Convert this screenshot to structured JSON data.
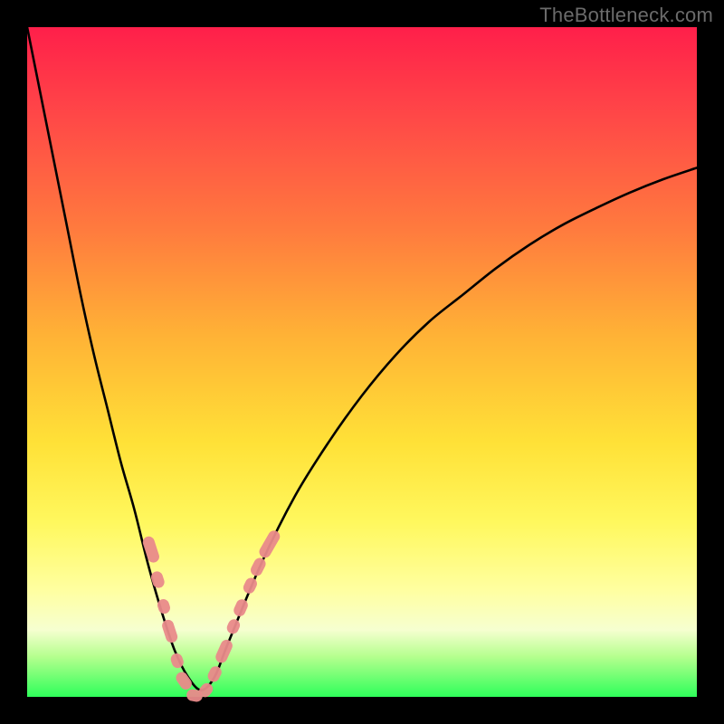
{
  "watermark": "TheBottleneck.com",
  "colors": {
    "background": "#000000",
    "gradient_stops": [
      "#ff1f4a",
      "#ff4a47",
      "#ff7a3e",
      "#ffb236",
      "#ffe137",
      "#fff85e",
      "#ffffa0",
      "#f6ffd0",
      "#b5ff8e",
      "#2eff5a"
    ],
    "curve": "#000000",
    "markers": "#e98a8a"
  },
  "chart_data": {
    "type": "line",
    "title": "",
    "xlabel": "",
    "ylabel": "",
    "xlim": [
      0,
      100
    ],
    "ylim": [
      0,
      100
    ],
    "series": [
      {
        "name": "bottleneck-curve",
        "x": [
          0,
          2,
          4,
          6,
          8,
          10,
          12,
          14,
          16,
          18,
          20,
          22,
          24,
          26,
          28,
          30,
          35,
          40,
          45,
          50,
          55,
          60,
          65,
          70,
          75,
          80,
          85,
          90,
          95,
          100
        ],
        "y": [
          100,
          90,
          80,
          70,
          60,
          51,
          43,
          35,
          28,
          20,
          13,
          7,
          3,
          1,
          3,
          8,
          20,
          30,
          38,
          45,
          51,
          56,
          60,
          64,
          67.5,
          70.5,
          73,
          75.3,
          77.3,
          79
        ]
      }
    ],
    "markers": [
      {
        "name": "highlight-cluster",
        "kind": "pill",
        "points": [
          {
            "x": 18.5,
            "y": 22,
            "len": 4,
            "angle": -72
          },
          {
            "x": 19.5,
            "y": 17.5,
            "len": 2.5,
            "angle": -72
          },
          {
            "x": 20.4,
            "y": 13.5,
            "len": 2.2,
            "angle": -72
          },
          {
            "x": 21.3,
            "y": 9.8,
            "len": 3.5,
            "angle": -72
          },
          {
            "x": 22.4,
            "y": 5.4,
            "len": 2.2,
            "angle": -70
          },
          {
            "x": 23.4,
            "y": 2.4,
            "len": 2.8,
            "angle": -55
          },
          {
            "x": 25.0,
            "y": 0.2,
            "len": 2.4,
            "angle": -10
          },
          {
            "x": 26.7,
            "y": 1.0,
            "len": 2.2,
            "angle": 50
          },
          {
            "x": 28.0,
            "y": 3.4,
            "len": 2.4,
            "angle": 63
          },
          {
            "x": 29.4,
            "y": 6.8,
            "len": 3.6,
            "angle": 66
          },
          {
            "x": 30.8,
            "y": 10.5,
            "len": 2.2,
            "angle": 66
          },
          {
            "x": 31.9,
            "y": 13.3,
            "len": 2.6,
            "angle": 66
          },
          {
            "x": 33.3,
            "y": 16.6,
            "len": 2.4,
            "angle": 64
          },
          {
            "x": 34.5,
            "y": 19.4,
            "len": 2.8,
            "angle": 63
          },
          {
            "x": 36.2,
            "y": 22.8,
            "len": 4.4,
            "angle": 60
          }
        ]
      }
    ]
  }
}
